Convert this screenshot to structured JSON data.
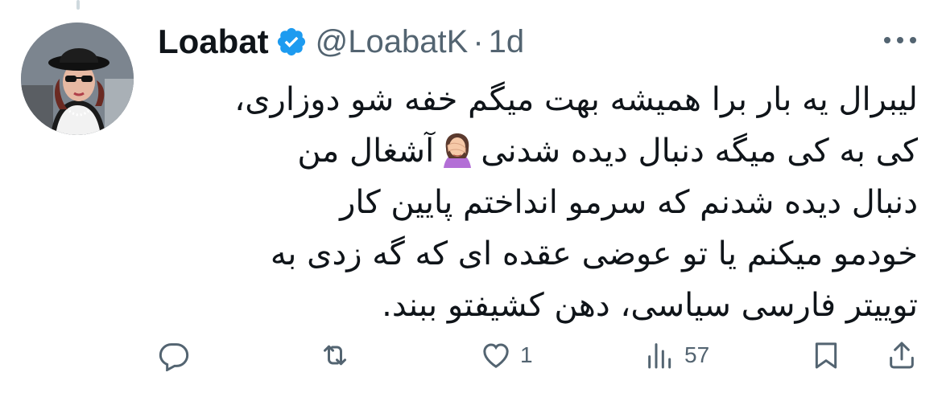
{
  "tweet": {
    "display_name": "Loabat",
    "handle": "@LoabatK",
    "separator": "·",
    "time": "1d",
    "text_lines": [
      "لیبرال یه بار برا همیشه بهت میگم خفه شو دوزاری،",
      "کی به کی میگه دنبال دیده شدنی",
      "آشغال من",
      "دنبال دیده شدنم که سرمو انداختم پایین کار",
      "خودمو میکنم یا تو عوضی عقده ای که گه زدی به",
      "توییتر فارسی سیاسی، دهن کشیفتو ببند."
    ],
    "emoji": "woman-facepalming"
  },
  "actions": {
    "reply_count": "",
    "retweet_count": "",
    "like_count": "1",
    "views_count": "57"
  },
  "icons": {
    "verified": "verified-badge-icon",
    "more": "more-options-icon",
    "reply": "reply-icon",
    "retweet": "retweet-icon",
    "like": "heart-icon",
    "views": "views-icon",
    "bookmark": "bookmark-icon",
    "share": "share-icon"
  },
  "colors": {
    "verified_blue": "#1d9bf0",
    "text": "#0f1419",
    "secondary": "#536471"
  }
}
